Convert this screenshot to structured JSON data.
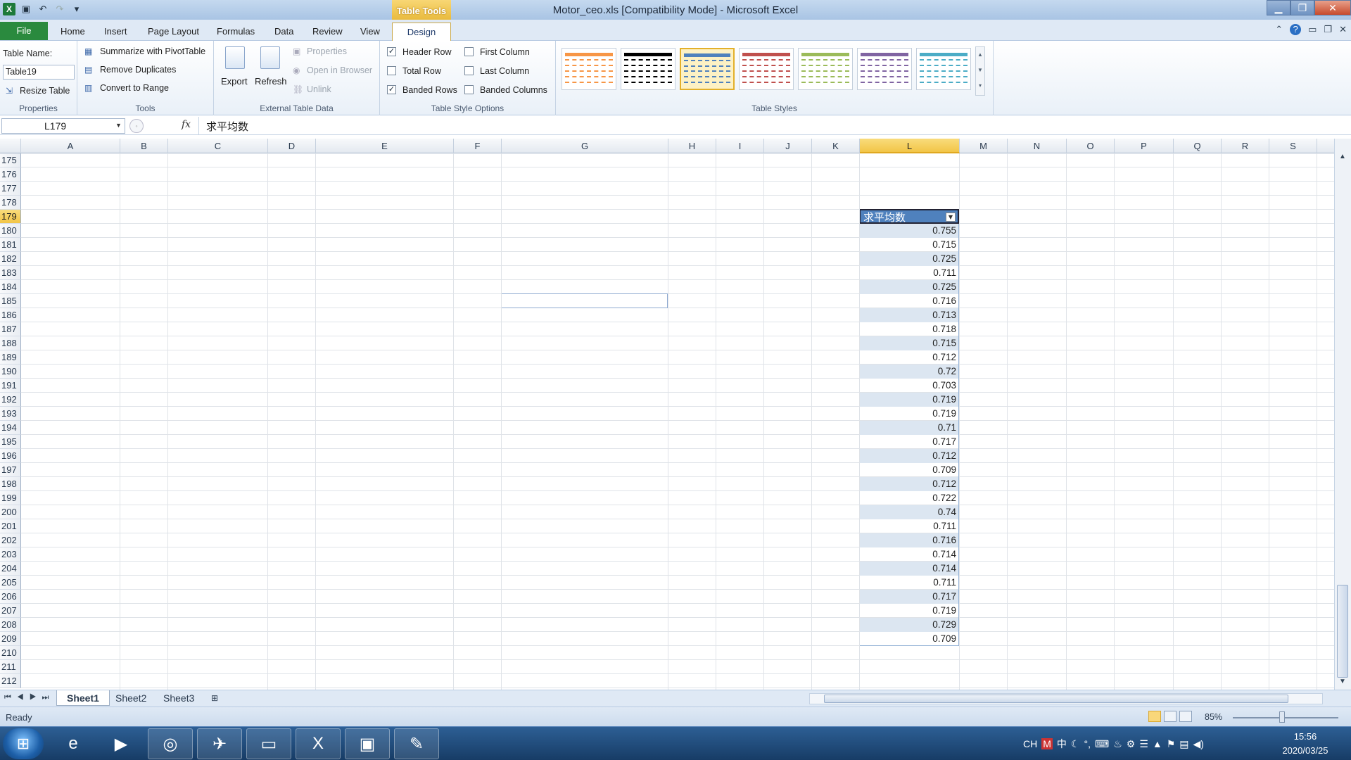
{
  "window": {
    "title": "Motor_ceo.xls  [Compatibility Mode]  -  Microsoft Excel",
    "context_tab": "Table Tools"
  },
  "ribbon_tabs": [
    "File",
    "Home",
    "Insert",
    "Page Layout",
    "Formulas",
    "Data",
    "Review",
    "View",
    "Design"
  ],
  "properties": {
    "table_name_label": "Table Name:",
    "table_name_value": "Table19",
    "resize": "Resize Table",
    "group": "Properties"
  },
  "tools": {
    "summarize": "Summarize with PivotTable",
    "remove_dup": "Remove Duplicates",
    "convert": "Convert to Range",
    "group": "Tools"
  },
  "external": {
    "export": "Export",
    "refresh": "Refresh",
    "properties": "Properties",
    "open_browser": "Open in Browser",
    "unlink": "Unlink",
    "group": "External Table Data"
  },
  "style_options": {
    "header_row": "Header Row",
    "total_row": "Total Row",
    "banded_rows": "Banded Rows",
    "first_column": "First Column",
    "last_column": "Last Column",
    "banded_columns": "Banded Columns",
    "group": "Table Style Options",
    "checked": {
      "header_row": true,
      "total_row": false,
      "banded_rows": true,
      "first_column": false,
      "last_column": false,
      "banded_columns": false
    }
  },
  "table_styles": {
    "group": "Table Styles",
    "colors": [
      "#f79646",
      "#000000",
      "#4f81bd",
      "#c0504d",
      "#9bbb59",
      "#8064a2",
      "#4bacc6"
    ],
    "selected_index": 2
  },
  "formula_bar": {
    "name_box": "L179",
    "fx": "fx",
    "formula": "求平均数"
  },
  "columns": [
    "A",
    "B",
    "C",
    "D",
    "E",
    "F",
    "G",
    "H",
    "I",
    "J",
    "K",
    "L",
    "M",
    "N",
    "O",
    "P",
    "Q",
    "R",
    "S"
  ],
  "selected_column": "L",
  "rows": [
    "175",
    "176",
    "177",
    "178",
    "179",
    "180",
    "181",
    "182",
    "183",
    "184",
    "185",
    "186",
    "187",
    "188",
    "189",
    "190",
    "191",
    "192",
    "193",
    "194",
    "195",
    "196",
    "197",
    "198",
    "199",
    "200",
    "201",
    "202",
    "203",
    "204",
    "205",
    "206",
    "207",
    "208",
    "209",
    "210",
    "211",
    "212"
  ],
  "selected_row": "179",
  "table": {
    "header": "求平均数",
    "values": [
      "0.755",
      "0.715",
      "0.725",
      "0.711",
      "0.725",
      "0.716",
      "0.713",
      "0.718",
      "0.715",
      "0.712",
      "0.72",
      "0.703",
      "0.719",
      "0.719",
      "0.71",
      "0.717",
      "0.712",
      "0.709",
      "0.712",
      "0.722",
      "0.74",
      "0.711",
      "0.716",
      "0.714",
      "0.714",
      "0.711",
      "0.717",
      "0.719",
      "0.729",
      "0.709"
    ]
  },
  "sheets": [
    "Sheet1",
    "Sheet2",
    "Sheet3"
  ],
  "active_sheet": "Sheet1",
  "status": {
    "ready": "Ready",
    "zoom": "85%"
  },
  "taskbar": {
    "lang": "CH",
    "ime": "中",
    "time": "15:56",
    "date": "2020/03/25"
  }
}
